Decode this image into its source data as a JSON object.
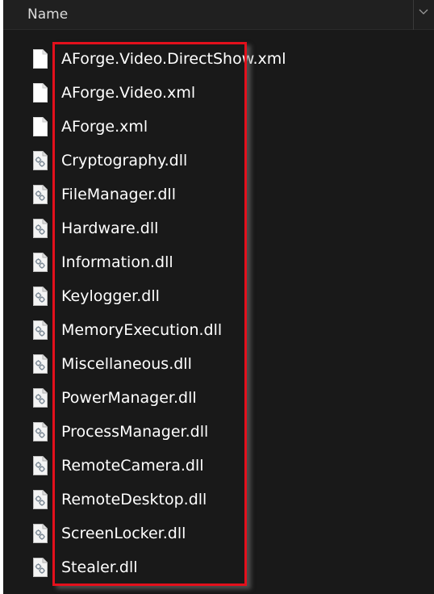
{
  "header": {
    "name_label": "Name",
    "sort_icon": "chevron-down-icon"
  },
  "colors": {
    "background": "#191919",
    "text": "#ffffff",
    "highlight": "#e3101c"
  },
  "files": [
    {
      "name": "AForge.Video.DirectShow.xml",
      "icon": "document-icon"
    },
    {
      "name": "AForge.Video.xml",
      "icon": "document-icon"
    },
    {
      "name": "AForge.xml",
      "icon": "document-icon"
    },
    {
      "name": "Cryptography.dll",
      "icon": "dll-file-icon"
    },
    {
      "name": "FileManager.dll",
      "icon": "dll-file-icon"
    },
    {
      "name": "Hardware.dll",
      "icon": "dll-file-icon"
    },
    {
      "name": "Information.dll",
      "icon": "dll-file-icon"
    },
    {
      "name": "Keylogger.dll",
      "icon": "dll-file-icon"
    },
    {
      "name": "MemoryExecution.dll",
      "icon": "dll-file-icon"
    },
    {
      "name": "Miscellaneous.dll",
      "icon": "dll-file-icon"
    },
    {
      "name": "PowerManager.dll",
      "icon": "dll-file-icon"
    },
    {
      "name": "ProcessManager.dll",
      "icon": "dll-file-icon"
    },
    {
      "name": "RemoteCamera.dll",
      "icon": "dll-file-icon"
    },
    {
      "name": "RemoteDesktop.dll",
      "icon": "dll-file-icon"
    },
    {
      "name": "ScreenLocker.dll",
      "icon": "dll-file-icon"
    },
    {
      "name": "Stealer.dll",
      "icon": "dll-file-icon"
    }
  ]
}
